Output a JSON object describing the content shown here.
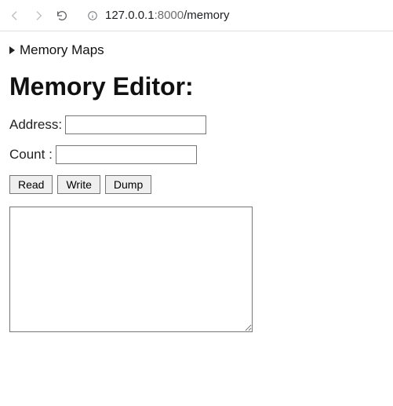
{
  "browser": {
    "url_host": "127.0.0.1",
    "url_port": ":8000",
    "url_path": "/memory"
  },
  "details": {
    "summary_label": "Memory Maps"
  },
  "heading": "Memory Editor:",
  "form": {
    "address_label": "Address:",
    "address_value": "",
    "count_label": "Count :",
    "count_value": ""
  },
  "buttons": {
    "read": "Read",
    "write": "Write",
    "dump": "Dump"
  },
  "output_value": ""
}
